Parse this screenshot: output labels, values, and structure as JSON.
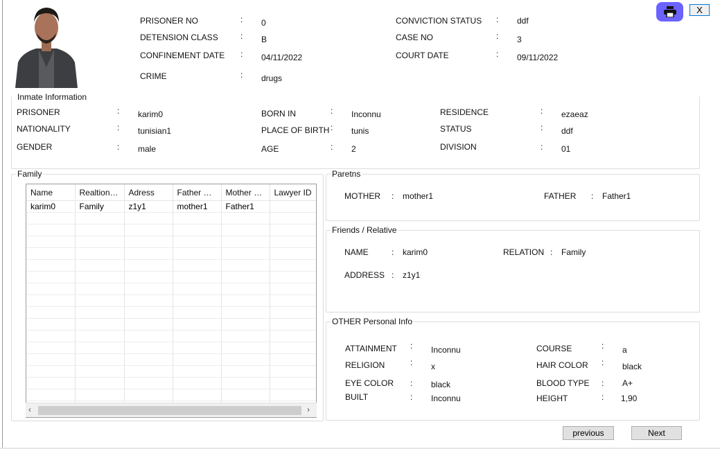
{
  "header": {
    "prisoner_no_label": "PRISONER NO",
    "prisoner_no": "0",
    "detension_class_label": "DETENSION CLASS",
    "detension_class": "B",
    "confinement_date_label": "CONFINEMENT DATE",
    "confinement_date": "04/11/2022",
    "crime_label": "CRIME",
    "crime": "drugs",
    "conviction_status_label": "CONVICTION STATUS",
    "conviction_status": "ddf",
    "case_no_label": "CASE NO",
    "case_no": "3",
    "court_date_label": "COURT DATE",
    "court_date": "09/11/2022",
    "colon": ":"
  },
  "window": {
    "close_label": "X",
    "print_icon": "printer-icon"
  },
  "inmate": {
    "title": "Inmate Information",
    "prisoner_label": "PRISONER",
    "prisoner": "karim0",
    "nationality_label": "NATIONALITY",
    "nationality": "tunisian1",
    "gender_label": "GENDER",
    "gender": "male",
    "born_in_label": "BORN IN",
    "born_in": "Inconnu",
    "place_of_birth_label": "PLACE OF BIRTH",
    "place_of_birth": "tunis",
    "age_label": "AGE",
    "age": "2",
    "residence_label": "RESIDENCE",
    "residence": "ezaeaz",
    "status_label": "STATUS",
    "status": "ddf",
    "division_label": "DIVISION",
    "division": "01"
  },
  "family": {
    "title": "Family",
    "columns": [
      "Name",
      "Realtionship",
      "Adress",
      "Father Na...",
      "Mother N...",
      "Lawyer ID"
    ],
    "rows": [
      [
        "karim0",
        "Family",
        "z1y1",
        "mother1",
        "Father1",
        ""
      ]
    ]
  },
  "parents": {
    "title": "Paretns",
    "mother_label": "MOTHER",
    "mother": "mother1",
    "father_label": "FATHER",
    "father": "Father1"
  },
  "friends": {
    "title": "Friends / Relative",
    "name_label": "NAME",
    "name": "karim0",
    "relation_label": "RELATION",
    "relation": "Family",
    "address_label": "ADDRESS",
    "address": "z1y1"
  },
  "other": {
    "title": "OTHER Personal Info",
    "attainment_label": "ATTAINMENT",
    "attainment": "Inconnu",
    "religion_label": "RELIGION",
    "religion": "x",
    "eye_color_label": "EYE COLOR",
    "eye_color": "black",
    "built_label": "BUILT",
    "built": "Inconnu",
    "course_label": "COURSE",
    "course": "a",
    "hair_color_label": "HAIR COLOR",
    "hair_color": "black",
    "blood_type_label": "BLOOD TYPE",
    "blood_type": "A+",
    "height_label": "HEIGHT",
    "height": "1,90"
  },
  "nav": {
    "previous_label": "previous",
    "next_label": "Next"
  },
  "colors": {
    "print_button": "#6c63ff",
    "close_border": "#0078d7"
  }
}
